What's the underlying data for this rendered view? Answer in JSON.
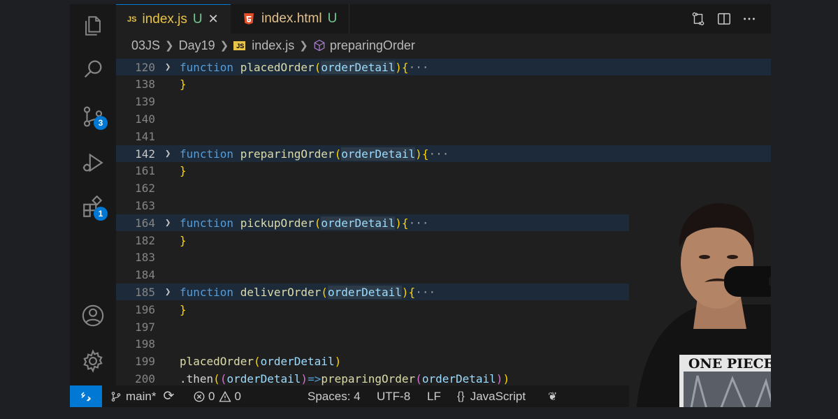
{
  "tabs": [
    {
      "name": "index.js",
      "status": "U",
      "icon": "javascript-file-icon",
      "active": true
    },
    {
      "name": "index.html",
      "status": "U",
      "icon": "html5-file-icon",
      "active": false
    }
  ],
  "breadcrumb": {
    "folder1": "03JS",
    "folder2": "Day19",
    "file": "index.js",
    "file_badge": "JS",
    "symbol": "preparingOrder"
  },
  "activity_badges": {
    "source_control": "3",
    "extensions": "1"
  },
  "code_lines": [
    {
      "num": "120",
      "type": "fn",
      "kw": "function",
      "name": "placedOrder",
      "param": "orderDetail"
    },
    {
      "num": "138",
      "type": "close",
      "text": "}"
    },
    {
      "num": "139",
      "type": "empty"
    },
    {
      "num": "140",
      "type": "empty"
    },
    {
      "num": "141",
      "type": "empty"
    },
    {
      "num": "142",
      "type": "fn",
      "kw": "function",
      "name": "preparingOrder",
      "param": "orderDetail",
      "current": true
    },
    {
      "num": "161",
      "type": "close",
      "text": "}"
    },
    {
      "num": "162",
      "type": "empty"
    },
    {
      "num": "163",
      "type": "empty"
    },
    {
      "num": "164",
      "type": "fn",
      "kw": "function",
      "name": "pickupOrder",
      "param": "orderDetail"
    },
    {
      "num": "182",
      "type": "close",
      "text": "}"
    },
    {
      "num": "183",
      "type": "empty"
    },
    {
      "num": "184",
      "type": "empty"
    },
    {
      "num": "185",
      "type": "fn",
      "kw": "function",
      "name": "deliverOrder",
      "param": "orderDetail"
    },
    {
      "num": "196",
      "type": "close",
      "text": "}"
    },
    {
      "num": "197",
      "type": "empty"
    },
    {
      "num": "198",
      "type": "empty"
    },
    {
      "num": "199",
      "type": "call",
      "name": "placedOrder",
      "param": "orderDetail"
    },
    {
      "num": "200",
      "type": "then",
      "method": ".then",
      "arg": "orderDetail",
      "arrow": "=>",
      "name": "preparingOrder",
      "param": "orderDetail"
    }
  ],
  "status": {
    "branch": "main*",
    "errors": "0",
    "warnings": "0",
    "spaces": "Spaces: 4",
    "encoding": "UTF-8",
    "eol": "LF",
    "language": "JavaScript"
  },
  "webcam": {
    "shirt_text": "ONE PIECE"
  },
  "colors": {
    "accent": "#0078d4",
    "keyword": "#569cd6",
    "function": "#dcdcaa",
    "param": "#9cdcfe",
    "bracket": "#ffd700",
    "untracked": "#73c991"
  }
}
